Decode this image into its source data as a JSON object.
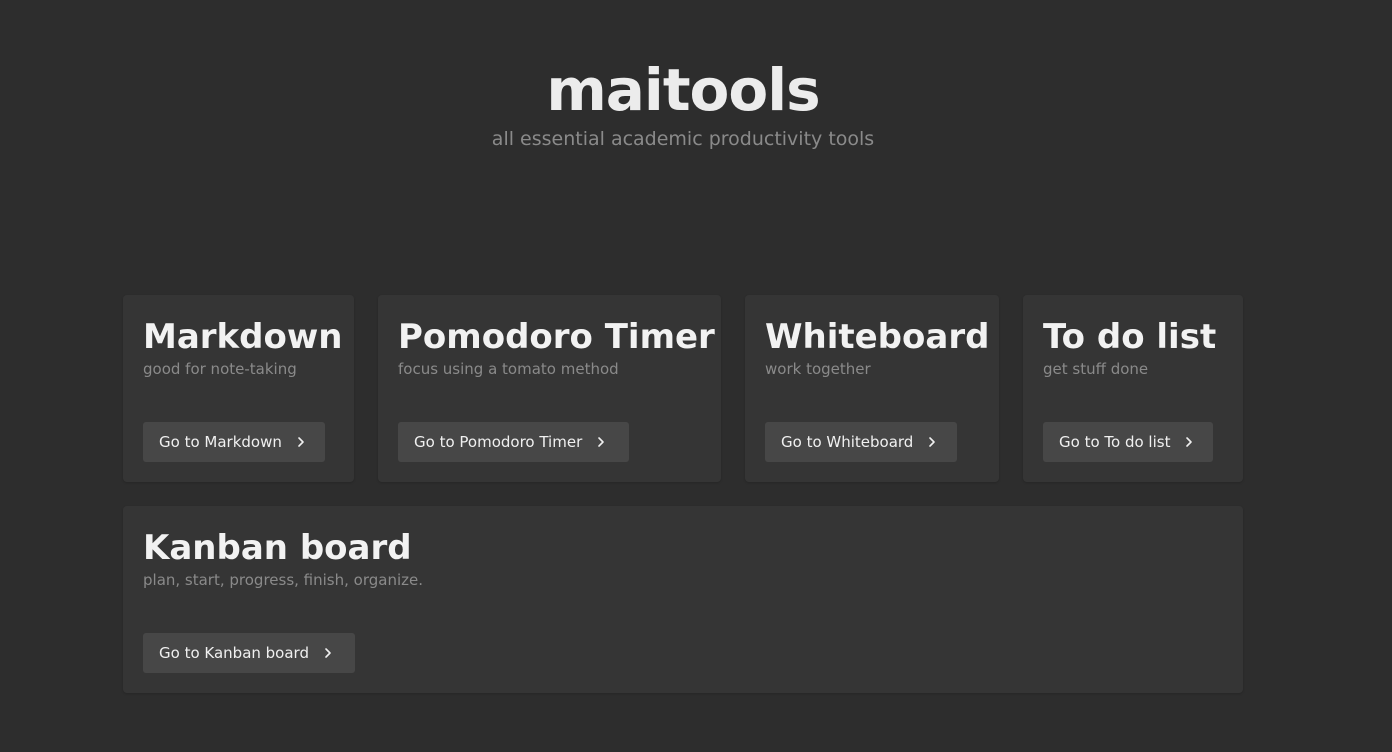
{
  "header": {
    "brand": "maitools",
    "tagline": "all essential academic productivity tools"
  },
  "tools": [
    {
      "title": "Markdown",
      "subtitle": "good for note-taking",
      "button_label": "Go to Markdown"
    },
    {
      "title": "Pomodoro Timer",
      "subtitle": "focus using a tomato method",
      "button_label": "Go to Pomodoro Timer"
    },
    {
      "title": "Whiteboard",
      "subtitle": "work together",
      "button_label": "Go to Whiteboard"
    },
    {
      "title": "To do list",
      "subtitle": "get stuff done",
      "button_label": "Go to To do list"
    },
    {
      "title": "Kanban board",
      "subtitle": "plan, start, progress, finish, organize.",
      "button_label": "Go to Kanban board"
    }
  ],
  "icons": {
    "button_arrow": "chevron-right-icon"
  },
  "colors": {
    "background": "#2d2d2d",
    "card": "#353535",
    "button": "#474747",
    "muted_text": "#8a8a8a"
  }
}
